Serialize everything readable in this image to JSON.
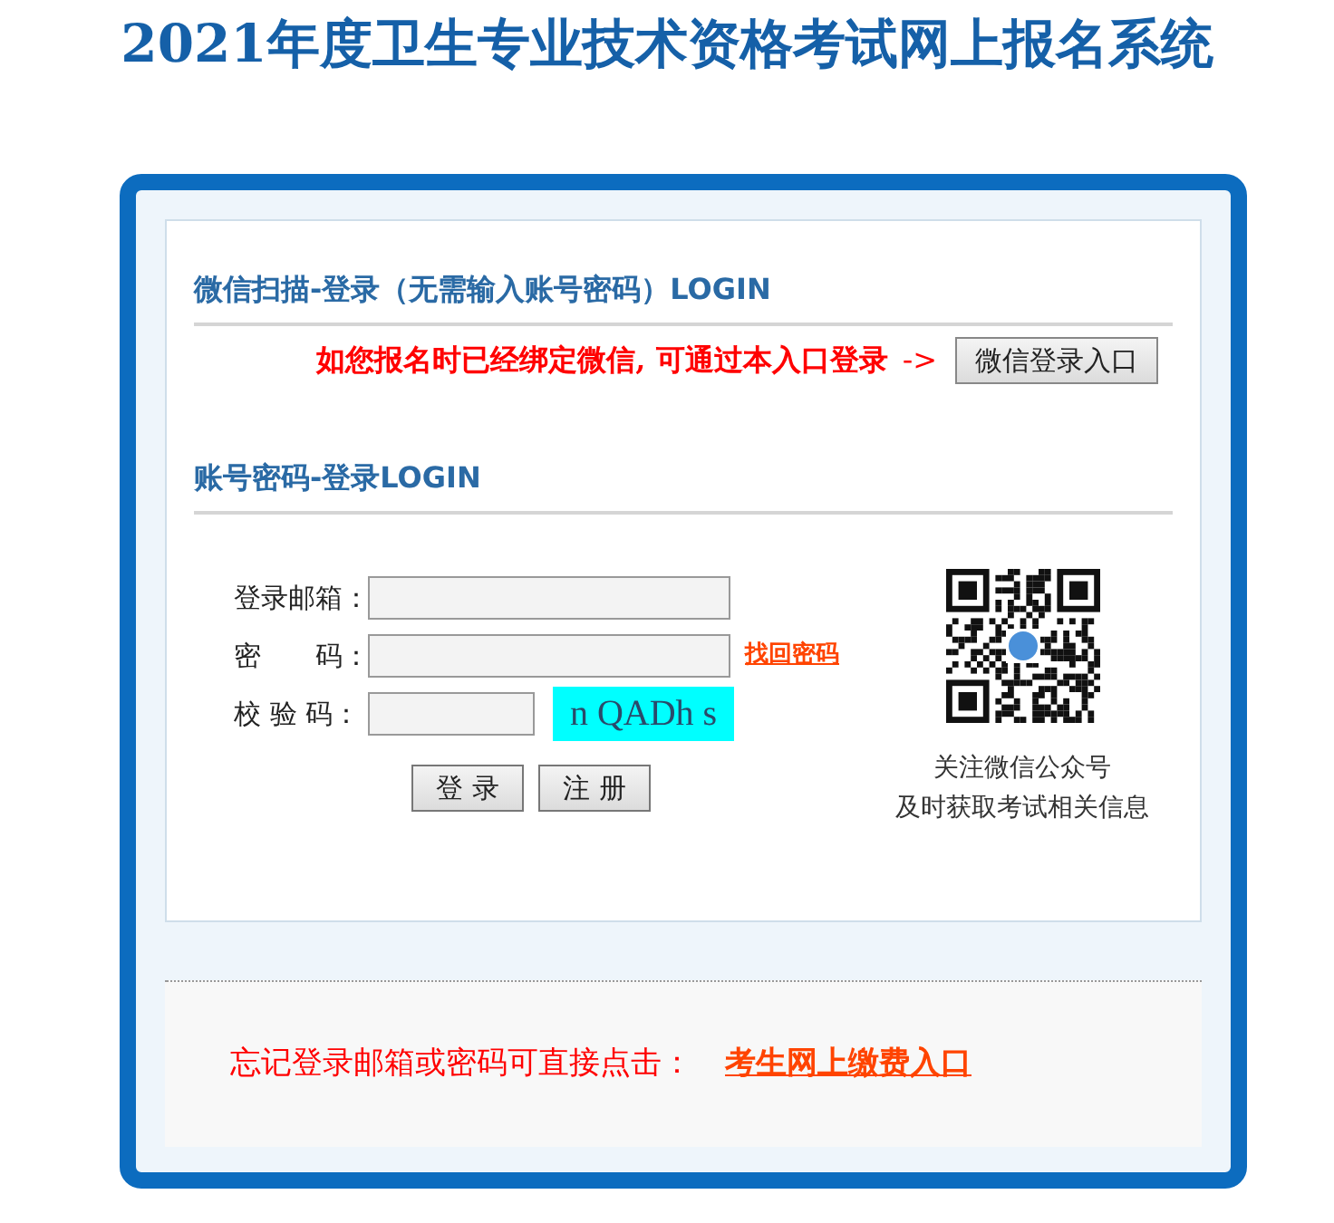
{
  "page_title": "2021年度卫生专业技术资格考试网上报名系统",
  "wechat_section": {
    "heading": "微信扫描-登录（无需输入账号密码）LOGIN",
    "notice": "如您报名时已经绑定微信, 可通过本入口登录",
    "arrow": "->",
    "button": "微信登录入口"
  },
  "account_section": {
    "heading": "账号密码-登录LOGIN",
    "fields": [
      {
        "kind": "text",
        "label": "登录邮箱："
      },
      {
        "kind": "password",
        "label": "密　　码：",
        "link": "找回密码"
      },
      {
        "kind": "captcha",
        "label": "校 验 码：",
        "captcha": "n QADh s"
      }
    ],
    "buttons": [
      "登 录",
      "注 册"
    ],
    "qr_caption": [
      "关注微信公众号",
      "及时获取考试相关信息"
    ]
  },
  "footer": {
    "text": "忘记登录邮箱或密码可直接点击：",
    "link": "考生网上缴费入口"
  }
}
